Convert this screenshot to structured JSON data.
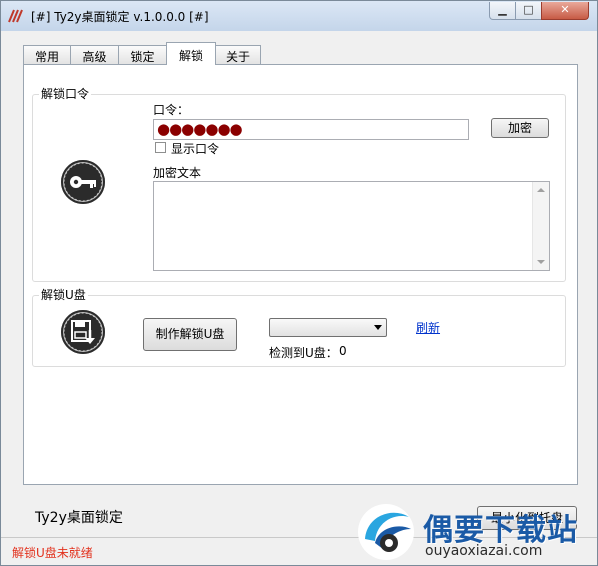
{
  "window": {
    "title": "[#] Ty2y桌面锁定 v.1.0.0.0 [#]"
  },
  "tabs": [
    {
      "label": "常用"
    },
    {
      "label": "高级"
    },
    {
      "label": "锁定"
    },
    {
      "label": "解锁",
      "active": true
    },
    {
      "label": "关于"
    }
  ],
  "unlock_password": {
    "group_label": "解锁口令",
    "password_label": "口令：",
    "password_mask": "●●●●●●●",
    "encrypt_button": "加密",
    "show_password_label": "显示口令",
    "show_password_checked": false,
    "encrypted_text_label": "加密文本",
    "encrypted_text_value": ""
  },
  "unlock_usb": {
    "group_label": "解锁U盘",
    "make_button": "制作解锁U盘",
    "drive_selected": "",
    "refresh_link": "刷新",
    "detected_label": "检测到U盘：",
    "detected_count": "0"
  },
  "footer": {
    "app_name": "Ty2y桌面锁定",
    "minimize_tray_button": "最小化到托盘"
  },
  "status": {
    "text": "解锁U盘未就绪",
    "color": "#e2311d"
  },
  "watermark": {
    "title": "偶要下载站",
    "url": "ouyaoxiazai.com"
  }
}
